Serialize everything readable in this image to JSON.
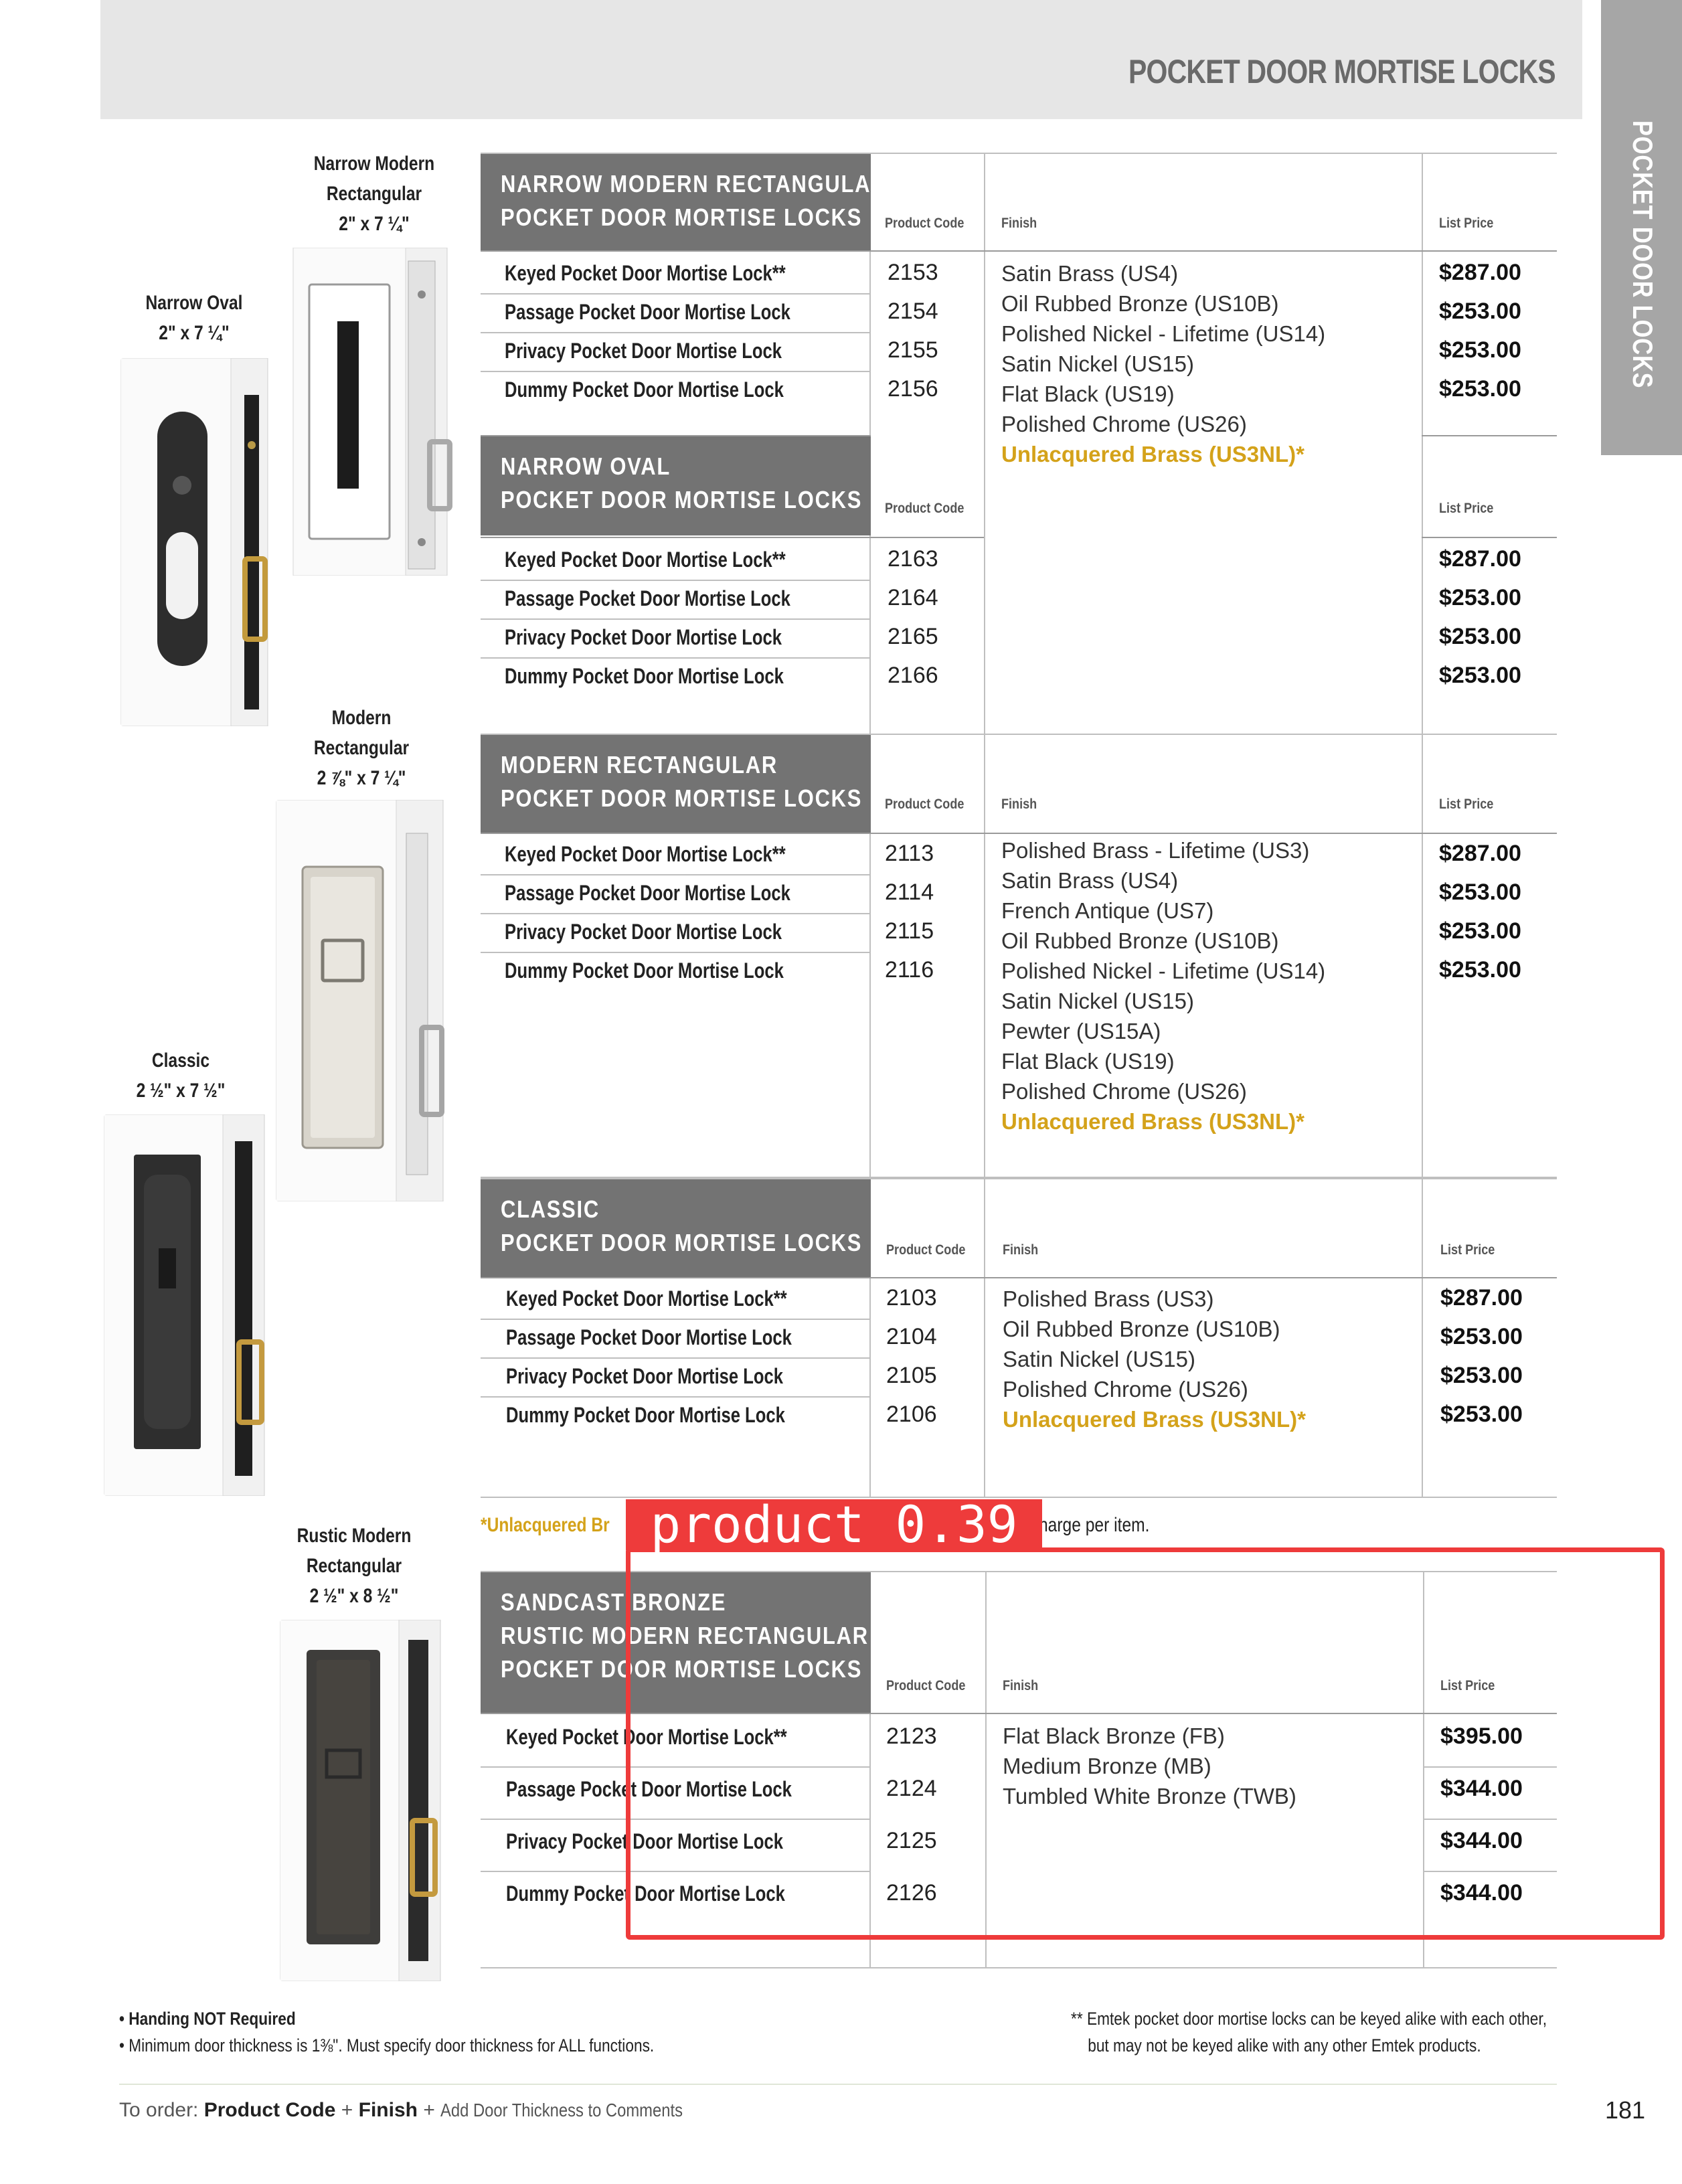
{
  "header": {
    "title": "POCKET DOOR MORTISE LOCKS",
    "side_tab": "POCKET DOOR LOCKS"
  },
  "photos": [
    {
      "id": "narrow-modern-rectangular",
      "lines": [
        "Narrow Modern",
        "Rectangular",
        "2\" x 7 ¼\""
      ]
    },
    {
      "id": "narrow-oval",
      "lines": [
        "Narrow Oval",
        "2\" x 7 ¼\""
      ]
    },
    {
      "id": "modern-rectangular",
      "lines": [
        "Modern",
        "Rectangular",
        "2 ⅞\" x 7 ¼\""
      ]
    },
    {
      "id": "classic",
      "lines": [
        "Classic",
        "2 ½\" x 7 ½\""
      ]
    },
    {
      "id": "rustic-modern-rectangular",
      "lines": [
        "Rustic Modern",
        "Rectangular",
        "2 ½\" x 8 ½\""
      ]
    }
  ],
  "column_labels": {
    "code": "Product Code",
    "finish": "Finish",
    "price": "List Price"
  },
  "tables": [
    {
      "heading": [
        "NARROW MODERN RECTANGULAR",
        "POCKET DOOR MORTISE LOCKS"
      ],
      "rows": [
        {
          "item": "Keyed Pocket Door Mortise Lock**",
          "code": "2153",
          "price": "$287.00"
        },
        {
          "item": "Passage Pocket Door Mortise Lock",
          "code": "2154",
          "price": "$253.00"
        },
        {
          "item": "Privacy Pocket Door Mortise Lock",
          "code": "2155",
          "price": "$253.00"
        },
        {
          "item": "Dummy Pocket Door Mortise Lock",
          "code": "2156",
          "price": "$253.00"
        }
      ],
      "finishes": [
        "Satin Brass (US4)",
        "Oil Rubbed Bronze (US10B)",
        "Polished Nickel - Lifetime (US14)",
        "Satin Nickel (US15)",
        "Flat Black (US19)",
        "Polished Chrome (US26)"
      ],
      "finish_highlight": "Unlacquered Brass (US3NL)*"
    },
    {
      "heading": [
        "NARROW OVAL",
        "POCKET DOOR MORTISE LOCKS"
      ],
      "rows": [
        {
          "item": "Keyed Pocket Door Mortise Lock**",
          "code": "2163",
          "price": "$287.00"
        },
        {
          "item": "Passage Pocket Door Mortise Lock",
          "code": "2164",
          "price": "$253.00"
        },
        {
          "item": "Privacy Pocket Door Mortise Lock",
          "code": "2165",
          "price": "$253.00"
        },
        {
          "item": "Dummy Pocket Door Mortise Lock",
          "code": "2166",
          "price": "$253.00"
        }
      ]
    },
    {
      "heading": [
        "MODERN RECTANGULAR",
        "POCKET DOOR MORTISE LOCKS"
      ],
      "rows": [
        {
          "item": "Keyed Pocket Door Mortise Lock**",
          "code": "2113",
          "price": "$287.00"
        },
        {
          "item": "Passage Pocket Door Mortise Lock",
          "code": "2114",
          "price": "$253.00"
        },
        {
          "item": "Privacy Pocket Door Mortise Lock",
          "code": "2115",
          "price": "$253.00"
        },
        {
          "item": "Dummy Pocket Door Mortise Lock",
          "code": "2116",
          "price": "$253.00"
        }
      ],
      "finishes": [
        "Polished Brass - Lifetime (US3)",
        "Satin Brass (US4)",
        "French Antique (US7)",
        "Oil Rubbed Bronze (US10B)",
        "Polished Nickel - Lifetime (US14)",
        "Satin Nickel (US15)",
        "Pewter (US15A)",
        "Flat Black (US19)",
        "Polished Chrome (US26)"
      ],
      "finish_highlight": "Unlacquered Brass (US3NL)*"
    },
    {
      "heading": [
        "CLASSIC",
        "POCKET DOOR MORTISE LOCKS"
      ],
      "rows": [
        {
          "item": "Keyed Pocket Door Mortise Lock**",
          "code": "2103",
          "price": "$287.00"
        },
        {
          "item": "Passage Pocket Door Mortise Lock",
          "code": "2104",
          "price": "$253.00"
        },
        {
          "item": "Privacy Pocket Door Mortise Lock",
          "code": "2105",
          "price": "$253.00"
        },
        {
          "item": "Dummy Pocket Door Mortise Lock",
          "code": "2106",
          "price": "$253.00"
        }
      ],
      "finishes": [
        "Polished Brass (US3)",
        "Oil Rubbed Bronze (US10B)",
        "Satin Nickel (US15)",
        "Polished Chrome (US26)"
      ],
      "finish_highlight": "Unlacquered Brass (US3NL)*"
    },
    {
      "heading": [
        "SANDCAST BRONZE",
        "RUSTIC MODERN RECTANGULAR",
        "POCKET DOOR MORTISE LOCKS"
      ],
      "rows": [
        {
          "item": "Keyed Pocket Door Mortise Lock**",
          "code": "2123",
          "price": "$395.00"
        },
        {
          "item": "Passage Pocket Door Mortise Lock",
          "code": "2124",
          "price": "$344.00"
        },
        {
          "item": "Privacy Pocket Door Mortise Lock",
          "code": "2125",
          "price": "$344.00"
        },
        {
          "item": "Dummy Pocket Door Mortise Lock",
          "code": "2126",
          "price": "$344.00"
        }
      ],
      "finishes": [
        "Flat Black Bronze (FB)",
        "Medium Bronze (MB)",
        "Tumbled White Bronze (TWB)"
      ]
    }
  ],
  "unlacquered_note": {
    "start": "*Unlacquered Br",
    "end": "harge per item."
  },
  "detection": {
    "label": "product 0.39"
  },
  "footnotes": {
    "left": [
      "• Handing NOT Required",
      "• Minimum door thickness is 1⅜\". Must specify door thickness for ALL functions."
    ],
    "right": [
      "** Emtek pocket door mortise locks can be keyed alike with each other,",
      "but may not be keyed alike with any other Emtek products."
    ]
  },
  "order": {
    "prefix": "To order:",
    "code": "Product Code",
    "plus1": "+",
    "finish": "Finish",
    "plus2": "+",
    "suffix": "Add Door Thickness to Comments"
  },
  "page_number": "181",
  "colors": {
    "header_band": "#e6e6e6",
    "side_tab": "#a6a6a6",
    "table_heading": "#737373",
    "highlight_gold": "#d4a21a",
    "detection_red": "#ee3b3b"
  }
}
